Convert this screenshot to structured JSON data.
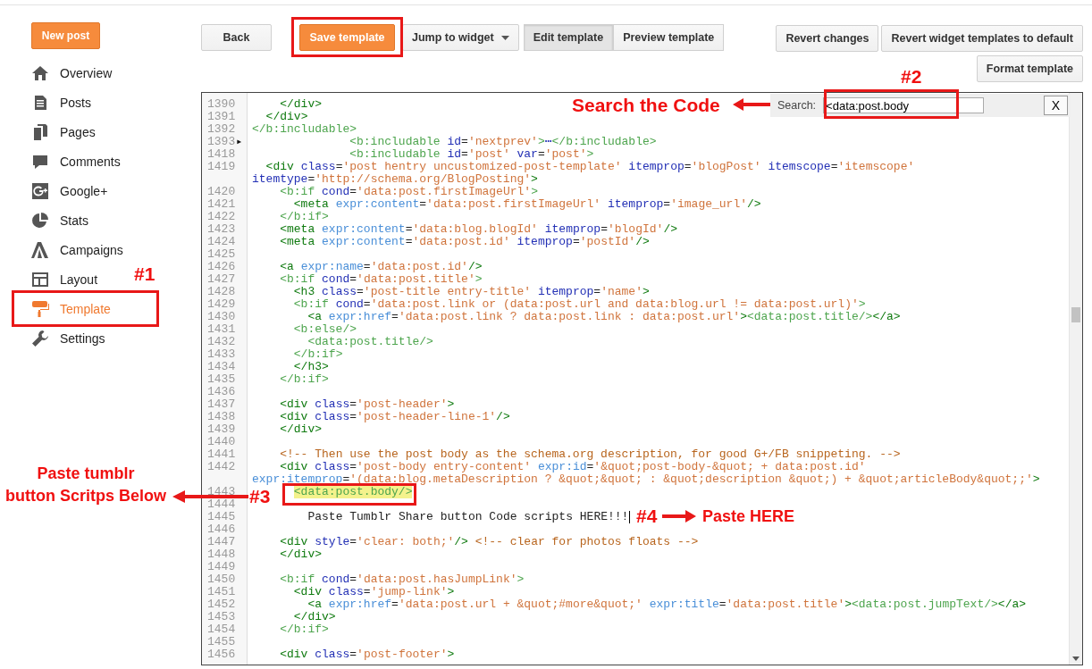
{
  "sidebar": {
    "new_post_button": "New post",
    "items": [
      {
        "label": "Overview",
        "selected": false
      },
      {
        "label": "Posts",
        "selected": false
      },
      {
        "label": "Pages",
        "selected": false
      },
      {
        "label": "Comments",
        "selected": false
      },
      {
        "label": "Google+",
        "selected": false
      },
      {
        "label": "Stats",
        "selected": false
      },
      {
        "label": "Campaigns",
        "selected": false
      },
      {
        "label": "Layout",
        "selected": false
      },
      {
        "label": "Template",
        "selected": true
      },
      {
        "label": "Settings",
        "selected": false
      }
    ]
  },
  "toolbar": {
    "back_button": "Back",
    "save_button": "Save template",
    "jump_dropdown": "Jump to widget",
    "view_tabs": [
      {
        "label": "Edit template",
        "selected": true
      },
      {
        "label": "Preview template",
        "selected": false
      }
    ],
    "revert_button": "Revert changes",
    "revert_widgets_button": "Revert widget templates to default",
    "format_button": "Format template"
  },
  "editor": {
    "search": {
      "label": "Search:",
      "value": "<data:post.body",
      "close": "X"
    },
    "lines": [
      {
        "number": "1390",
        "code": "    </div>"
      },
      {
        "number": "1391",
        "code": "  </div>"
      },
      {
        "number": "1392",
        "code": "</b:includable>"
      },
      {
        "number": "1393",
        "fold_marker": "▶",
        "code": "              <b:includable id='nextprev'>⋯</b:includable>"
      },
      {
        "number": "1418",
        "code": "              <b:includable id='post' var='post'>"
      },
      {
        "number": "1419",
        "code": "  <div class='post hentry uncustomized-post-template' itemprop='blogPost' itemscope='itemscope'",
        "wrap": "itemtype='http://schema.org/BlogPosting'>"
      },
      {
        "number": "1420",
        "code": "    <b:if cond='data:post.firstImageUrl'>"
      },
      {
        "number": "1421",
        "code": "      <meta expr:content='data:post.firstImageUrl' itemprop='image_url'/>"
      },
      {
        "number": "1422",
        "code": "    </b:if>"
      },
      {
        "number": "1423",
        "code": "    <meta expr:content='data:blog.blogId' itemprop='blogId'/>"
      },
      {
        "number": "1424",
        "code": "    <meta expr:content='data:post.id' itemprop='postId'/>"
      },
      {
        "number": "1425"
      },
      {
        "number": "1426",
        "code": "    <a expr:name='data:post.id'/>"
      },
      {
        "number": "1427",
        "code": "    <b:if cond='data:post.title'>"
      },
      {
        "number": "1428",
        "code": "      <h3 class='post-title entry-title' itemprop='name'>"
      },
      {
        "number": "1429",
        "code": "      <b:if cond='data:post.link or (data:post.url and data:blog.url != data:post.url)'>"
      },
      {
        "number": "1430",
        "code": "        <a expr:href='data:post.link ? data:post.link : data:post.url'><data:post.title/></a>"
      },
      {
        "number": "1431",
        "code": "      <b:else/>"
      },
      {
        "number": "1432",
        "code": "        <data:post.title/>"
      },
      {
        "number": "1433",
        "code": "      </b:if>"
      },
      {
        "number": "1434",
        "code": "      </h3>"
      },
      {
        "number": "1435",
        "code": "    </b:if>"
      },
      {
        "number": "1436"
      },
      {
        "number": "1437",
        "code": "    <div class='post-header'>"
      },
      {
        "number": "1438",
        "code": "    <div class='post-header-line-1'/>"
      },
      {
        "number": "1439",
        "code": "    </div>"
      },
      {
        "number": "1440"
      },
      {
        "number": "1441",
        "code": "    <!-- Then use the post body as the schema.org description, for good G+/FB snippeting. -->"
      },
      {
        "number": "1442",
        "code": "    <div class='post-body entry-content' expr:id='&quot;post-body-&quot; + data:post.id'",
        "wrap": "expr:itemprop='(data:blog.metaDescription ? &quot;&quot; : &quot;description &quot;) + &quot;articleBody&quot;;'>"
      },
      {
        "number": "1443",
        "code": "      <data:post.body/>",
        "highlighted": true
      },
      {
        "number": "1444"
      },
      {
        "number": "1445",
        "code": "        Paste Tumblr Share button Code scripts HERE!!!",
        "cursor": true
      },
      {
        "number": "1446"
      },
      {
        "number": "1447",
        "code": "    <div style='clear: both;'/> <!-- clear for photos floats -->"
      },
      {
        "number": "1448",
        "code": "    </div>"
      },
      {
        "number": "1449"
      },
      {
        "number": "1450",
        "code": "    <b:if cond='data:post.hasJumpLink'>"
      },
      {
        "number": "1451",
        "code": "      <div class='jump-link'>"
      },
      {
        "number": "1452",
        "code": "        <a expr:href='data:post.url + &quot;#more&quot;' expr:title='data:post.title'><data:post.jumpText/></a>"
      },
      {
        "number": "1453",
        "code": "      </div>"
      },
      {
        "number": "1454",
        "code": "    </b:if>"
      },
      {
        "number": "1455"
      },
      {
        "number": "1456",
        "code": "    <div class='post-footer'>"
      }
    ]
  },
  "annotations": {
    "step_labels": [
      "#1",
      "#2",
      "#3",
      "#4"
    ],
    "notes": [
      {
        "lines": [
          "Search the Code"
        ]
      },
      {
        "lines": [
          "Paste tumblr",
          "button Scritps Below"
        ]
      },
      {
        "lines": [
          "Paste HERE"
        ]
      }
    ]
  }
}
